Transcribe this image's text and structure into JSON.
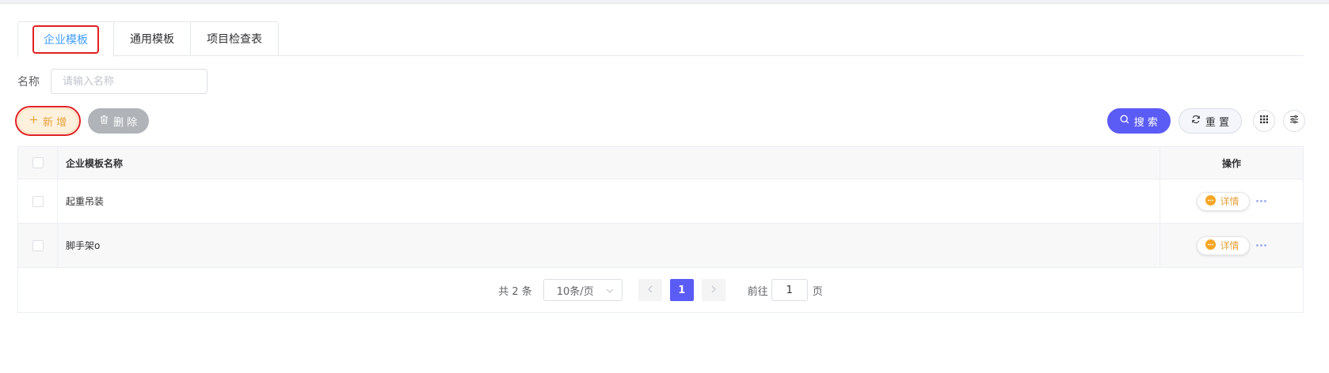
{
  "tabs": [
    {
      "label": "企业模板",
      "active": true
    },
    {
      "label": "通用模板",
      "active": false
    },
    {
      "label": "项目检查表",
      "active": false
    }
  ],
  "search_form": {
    "name_label": "名称",
    "name_placeholder": "请输入名称",
    "name_value": ""
  },
  "toolbar": {
    "add_label": "新 增",
    "delete_label": "删 除",
    "search_label": "搜 索",
    "reset_label": "重 置"
  },
  "table": {
    "columns": [
      "企业模板名称",
      "操作"
    ],
    "rows": [
      {
        "name": "起重吊装",
        "action_label": "详情"
      },
      {
        "name": "脚手架o",
        "action_label": "详情"
      }
    ]
  },
  "pagination": {
    "total_text": "共 2 条",
    "page_size": "10条/页",
    "current_page": "1",
    "jump_label": "前往",
    "jump_value": "1",
    "jump_suffix": "页"
  },
  "colors": {
    "accent": "#5b5bf5",
    "tab_active": "#409eff",
    "warning": "#e6a23c",
    "highlight_outline": "#e02020"
  }
}
